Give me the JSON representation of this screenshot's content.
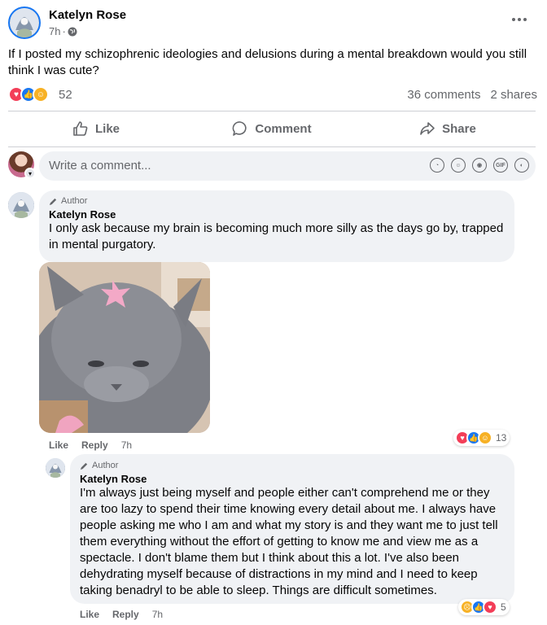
{
  "post": {
    "author": "Katelyn Rose",
    "time": "7h",
    "separator": "·",
    "text": "If I posted my schizophrenic ideologies and delusions during a mental breakdown would you still think I was cute?",
    "reaction_count": "52",
    "comments": "36 comments",
    "shares": "2 shares"
  },
  "actions": {
    "like": "Like",
    "comment": "Comment",
    "share": "Share"
  },
  "composer": {
    "placeholder": "Write a comment..."
  },
  "comments": [
    {
      "badge": "Author",
      "name": "Katelyn Rose",
      "text": "I only ask because my brain is becoming much more silly as the days go by, trapped in mental purgatory.",
      "like": "Like",
      "reply": "Reply",
      "time": "7h",
      "reaction_count": "13"
    },
    {
      "badge": "Author",
      "name": "Katelyn Rose",
      "text": "I'm always just being myself and people either can't comprehend me or they are too lazy to spend their time knowing every detail about me. I always have people asking me who I am and what my story is and they want me to just tell them everything without the effort of getting to know me and view me as a spectacle. I don't blame them but I think about this a lot. I've also been dehydrating myself because of distractions in my mind and I need to keep taking benadryl to be able to sleep. Things are difficult sometimes.",
      "like": "Like",
      "reply": "Reply",
      "time": "7h",
      "reaction_count": "5"
    }
  ],
  "colors": {
    "facebook_blue": "#1877f2",
    "love_red": "#f33e58",
    "care_yellow": "#f7b125",
    "secondary_text": "#65676b",
    "bubble_bg": "#f0f2f5"
  }
}
